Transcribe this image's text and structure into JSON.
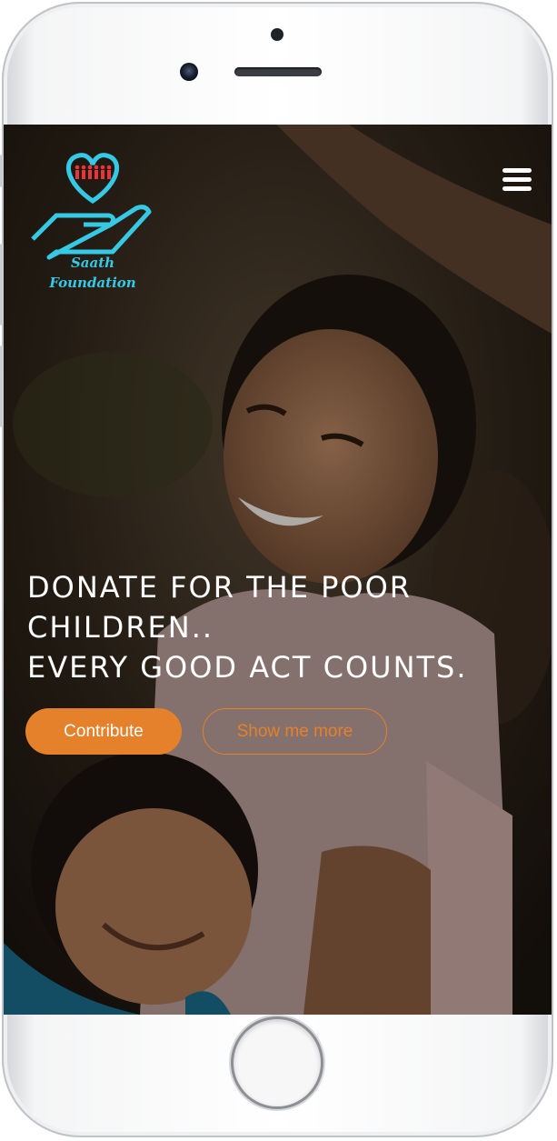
{
  "brand": {
    "name_line1": "Saath",
    "name_line2": "Foundation",
    "accent_color": "#35c9e6",
    "heart_color": "#e8353a",
    "logo_icon": "heart-hand-icon"
  },
  "nav": {
    "menu_icon": "hamburger-menu-icon"
  },
  "hero": {
    "headline_lines": [
      "DONATE FOR THE POOR",
      "CHILDREN..",
      "EVERY GOOD ACT COUNTS."
    ],
    "primary_button": "Contribute",
    "secondary_button": "Show me more",
    "button_color": "#e6812b"
  },
  "device": {
    "home_button_icon": "home-button-icon",
    "camera_icon": "front-camera-icon"
  }
}
